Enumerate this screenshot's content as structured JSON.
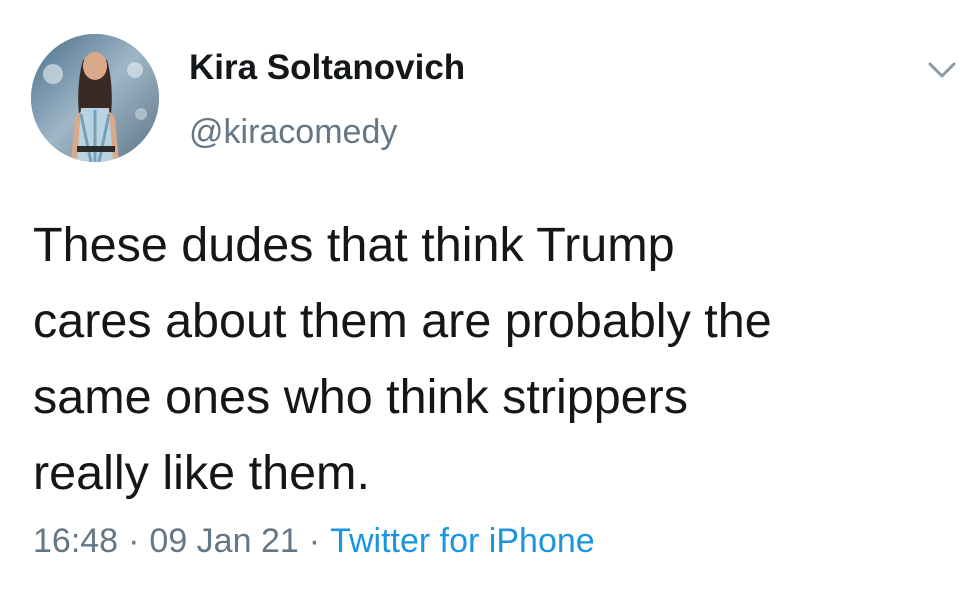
{
  "tweet": {
    "author_name": "Kira Soltanovich",
    "author_handle": "@kiracomedy",
    "text": "These dudes that think Trump\ncares about them are probably the\nsame ones who think strippers\nreally like them.",
    "time": "16:48",
    "separator": "·",
    "date": "09 Jan 21",
    "source": "Twitter for iPhone"
  },
  "icons": {
    "avatar": "profile-photo",
    "menu": "chevron-down-icon"
  },
  "colors": {
    "text": "#14171a",
    "secondary_text": "#657786",
    "link": "#1b95e0",
    "background": "#ffffff"
  }
}
